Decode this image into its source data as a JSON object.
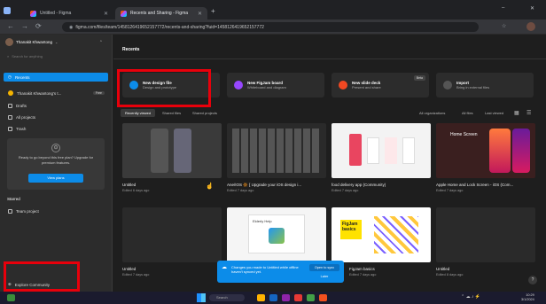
{
  "browser": {
    "tabs": [
      {
        "title": "Untitled - Figma",
        "active": false
      },
      {
        "title": "Recents and Sharing - Figma",
        "active": true
      }
    ],
    "new_tab": "+",
    "window_controls": {
      "minimize": "–",
      "close": "✕"
    },
    "url": "figma.com/files/team/1458126419652157772/recents-and-sharing?fuid=1458126419652157772"
  },
  "sidebar": {
    "user_name": "Thanakit Khwantong",
    "search_placeholder": "Search for anything",
    "recents": "Recents",
    "team_name": "Thanakit Khwantong's t...",
    "team_badge": "Free",
    "items": [
      "Drafts",
      "All projects",
      "Trash"
    ],
    "upgrade_text": "Ready to go beyond this free plan? Upgrade for premium features.",
    "view_plans": "View plans",
    "starred_heading": "Starred",
    "starred_items": [
      "Team project"
    ],
    "explore": "Explore Community"
  },
  "main": {
    "title": "Recents",
    "create_cards": [
      {
        "title": "New design file",
        "subtitle": "Design and prototype",
        "color": "#0c8ce9"
      },
      {
        "title": "New FigJam board",
        "subtitle": "Whiteboard and diagram",
        "color": "#9747ff"
      },
      {
        "title": "New slide deck",
        "subtitle": "Present and share",
        "color": "#f24822",
        "badge": "Beta"
      },
      {
        "title": "Import",
        "subtitle": "Bring in external files",
        "color": "#555555"
      }
    ],
    "filters": [
      "Recently viewed",
      "Shared files",
      "Shared projects"
    ],
    "sort": {
      "org": "All organizations",
      "files": "All files",
      "viewed": "Last viewed"
    },
    "files": [
      {
        "title": "Untitled",
        "sub": "Edited 6 days ago"
      },
      {
        "title": "Ane/ΙOS 🔆 [ Upgrade your iOS design i...",
        "sub": "Edited 7 days ago"
      },
      {
        "title": "food delivery app (Community)",
        "sub": "Edited 7 days ago"
      },
      {
        "title": "Apple Home and Lock Screen - iOS (Com...",
        "sub": "Edited 7 days ago"
      },
      {
        "title": "Untitled",
        "sub": "Edited 7 days ago"
      },
      {
        "title": "Elderly Help",
        "sub": "Edited 7 days ago"
      },
      {
        "title": "FigJam basics",
        "sub": "Edited 7 days ago"
      },
      {
        "title": "Untitled",
        "sub": "Edited 8 days ago"
      }
    ],
    "thumb_text": {
      "home_screen": "Home Screen",
      "figjam": "FigJam basics",
      "elderly": "Elderly Help"
    },
    "toast": {
      "message": "Changes you made to Untitled while offline haven't synced yet.",
      "action1": "Open to sync",
      "action2": "Later"
    },
    "help": "?"
  },
  "taskbar": {
    "search": "Search",
    "time": "10:29",
    "date": "3/1/2024"
  }
}
